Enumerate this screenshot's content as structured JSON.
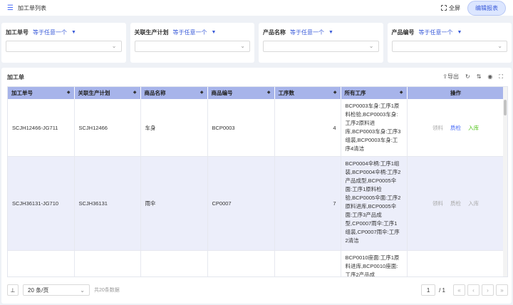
{
  "header": {
    "title": "加工单列表",
    "fullscreen_label": "全屏",
    "edit_report_label": "编辑报表"
  },
  "filters": [
    {
      "label": "加工单号",
      "operator": "等于任意一个"
    },
    {
      "label": "关联生产计划",
      "operator": "等于任意一个"
    },
    {
      "label": "产品名称",
      "operator": "等于任意一个"
    },
    {
      "label": "产品编号",
      "operator": "等于任意一个"
    }
  ],
  "panel": {
    "title": "加工单",
    "export_label": "导出"
  },
  "table": {
    "columns": [
      "加工单号",
      "关联生产计划",
      "商品名称",
      "商品编号",
      "工序数",
      "所有工序",
      "操作"
    ],
    "rows": [
      {
        "order_no": "SCJH12466-JG711",
        "plan": "SCJH12466",
        "product_name": "车身",
        "product_no": "BCP0003",
        "steps": "4",
        "processes": "BCP0003车身:工序1原料检验,BCP0003车身:工序2原料进库,BCP0003车身:工序3组装,BCP0003车身:工序4清洁",
        "actions": [
          "领料",
          "质检",
          "入库"
        ]
      },
      {
        "order_no": "SCJH36131-JG710",
        "plan": "SCJH36131",
        "product_name": "雨伞",
        "product_no": "CP0007",
        "steps": "7",
        "processes": "BCP0004伞柄:工序1组装,BCP0004伞柄:工序2产品成型,BCP0005伞面:工序1原料检验,BCP0005伞面:工序2原料进库,BCP0005伞面:工序3产品成型,CP0007雨伞:工序1组装,CP0007雨伞:工序2清洁",
        "actions": [
          "领料",
          "质检",
          "入库"
        ]
      },
      {
        "order_no": "",
        "plan": "",
        "product_name": "",
        "product_no": "",
        "steps": "",
        "processes": "BCP0010座面:工序1原料进库,BCP0010座面:工序2产品成",
        "actions": []
      }
    ]
  },
  "footer": {
    "page_size": "20 条/页",
    "total": "共20条数据",
    "current_page": "1",
    "total_pages": "/ 1"
  }
}
